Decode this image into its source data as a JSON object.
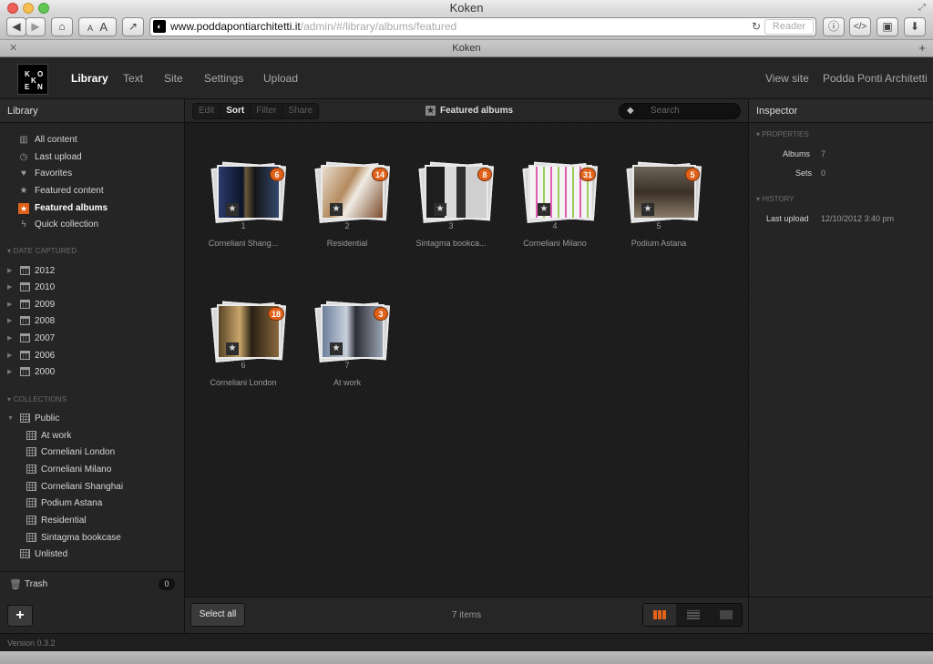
{
  "window": {
    "title": "Koken",
    "tab_title": "Koken"
  },
  "browser": {
    "url_domain": "www.poddapontiarchitetti.it",
    "url_path": "/admin/#/library/albums/featured",
    "reader_label": "Reader",
    "font_small": "A",
    "font_large": "A"
  },
  "app": {
    "logo_letters": [
      "K",
      "O",
      "K",
      "E",
      "N"
    ],
    "nav": [
      "Library",
      "Text",
      "Site",
      "Settings",
      "Upload"
    ],
    "view_site": "View site",
    "site_name": "Podda Ponti Architetti"
  },
  "sidebar": {
    "title": "Library",
    "items": [
      {
        "label": "All content",
        "icon": "bar-chart-icon"
      },
      {
        "label": "Last upload",
        "icon": "clock-icon"
      },
      {
        "label": "Favorites",
        "icon": "heart-icon"
      },
      {
        "label": "Featured content",
        "icon": "star-icon"
      },
      {
        "label": "Featured albums",
        "icon": "featured-album-icon"
      },
      {
        "label": "Quick collection",
        "icon": "bolt-icon"
      }
    ],
    "date_section": "DATE CAPTURED",
    "years": [
      "2012",
      "2010",
      "2009",
      "2008",
      "2007",
      "2006",
      "2000"
    ],
    "collections_section": "COLLECTIONS",
    "public_label": "Public",
    "albums": [
      "At work",
      "Corneliani London",
      "Corneliani Milano",
      "Corneliani Shanghai",
      "Podium Astana",
      "Residential",
      "Sintagma bookcase"
    ],
    "unlisted_label": "Unlisted",
    "trash_label": "Trash",
    "trash_count": "0",
    "add_label": "+"
  },
  "main": {
    "toolbar": [
      "Edit",
      "Sort",
      "Filter",
      "Share"
    ],
    "breadcrumb": "Featured albums",
    "search_placeholder": "Search",
    "albums": [
      {
        "num": "1",
        "name": "Corneliani Shang...",
        "count": "6"
      },
      {
        "num": "2",
        "name": "Residential",
        "count": "14"
      },
      {
        "num": "3",
        "name": "Sintagma bookca...",
        "count": "8"
      },
      {
        "num": "4",
        "name": "Corneliani Milano",
        "count": "31"
      },
      {
        "num": "5",
        "name": "Podium Astana",
        "count": "5"
      },
      {
        "num": "6",
        "name": "Corneliani London",
        "count": "18"
      },
      {
        "num": "7",
        "name": "At work",
        "count": "3"
      }
    ],
    "select_all": "Select all",
    "item_count": "7 items"
  },
  "inspector": {
    "title": "Inspector",
    "properties_section": "PROPERTIES",
    "albums_key": "Albums",
    "albums_val": "7",
    "sets_key": "Sets",
    "sets_val": "0",
    "history_section": "HISTORY",
    "last_upload_key": "Last upload",
    "last_upload_val": "12/10/2012 3:40 pm"
  },
  "status": {
    "version": "Version 0.3.2"
  },
  "colors": {
    "accent": "#e0621a",
    "bg": "#1c1c1c",
    "panel": "#252525"
  }
}
